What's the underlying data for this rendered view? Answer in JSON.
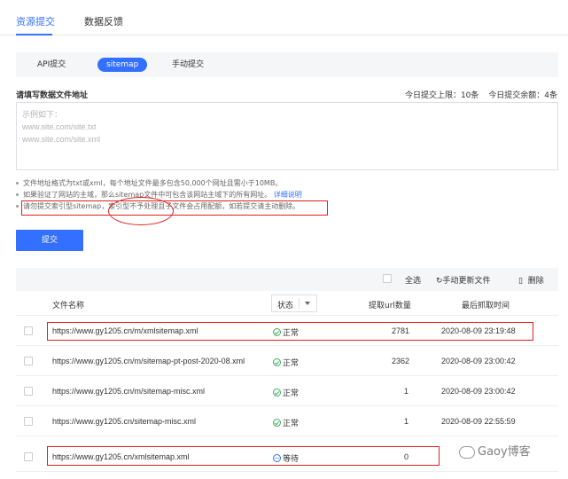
{
  "top_tabs": [
    {
      "label": "资源提交",
      "active": true
    },
    {
      "label": "数据反馈",
      "active": false
    }
  ],
  "sub_tabs": [
    {
      "label": "API提交",
      "active": false
    },
    {
      "label": "sitemap",
      "active": true
    },
    {
      "label": "手动提交",
      "active": false
    }
  ],
  "form": {
    "label": "请填写数据文件地址",
    "quota_limit": "今日提交上限：10条",
    "quota_remaining": "今日提交余额：4条",
    "placeholder_lines": [
      "示例如下：",
      "www.site.com/site.txt",
      "www.site.com/site.xml"
    ]
  },
  "notes": {
    "note1": "文件地址格式为txt或xml，每个地址文件最多包含50,000个网址且需小于10MB。",
    "note2": "如果验证了网站的主域，那么sitemap文件中可包含该网站主域下的所有网址。",
    "note2_link": "详细说明",
    "note3": "请勿提交索引型sitemap，索引型不予处理且子文件会占用配额，如若提交请主动删除。"
  },
  "submit_label": "提交",
  "toolbar": {
    "select_all": "全选",
    "refresh": "手动更新文件",
    "delete": "删除"
  },
  "table": {
    "headers": {
      "file_name": "文件名称",
      "status": "状态",
      "url_count": "提取url数量",
      "last_fetch": "最后抓取时间"
    },
    "rows": [
      {
        "file": "https://www.gy1205.cn/m/xmlsitemap.xml",
        "status": "正常",
        "status_type": "ok",
        "count": "2781",
        "time": "2020-08-09 23:19:48"
      },
      {
        "file": "https://www.gy1205.cn/m/sitemap-pt-post-2020-08.xml",
        "status": "正常",
        "status_type": "ok",
        "count": "2362",
        "time": "2020-08-09 23:00:42"
      },
      {
        "file": "https://www.gy1205.cn/m/sitemap-misc.xml",
        "status": "正常",
        "status_type": "ok",
        "count": "1",
        "time": "2020-08-09 23:00:42"
      },
      {
        "file": "https://www.gy1205.cn/sitemap-misc.xml",
        "status": "正常",
        "status_type": "ok",
        "count": "1",
        "time": "2020-08-09 22:55:59"
      },
      {
        "file": "https://www.gy1205.cn/xmlsitemap.xml",
        "status": "等待",
        "status_type": "wait",
        "count": "0",
        "time": ""
      }
    ]
  },
  "watermark": "Gaoy博客",
  "colors": {
    "accent": "#3370ff",
    "annotation_red": "#e02020",
    "status_ok": "#3dae60"
  }
}
